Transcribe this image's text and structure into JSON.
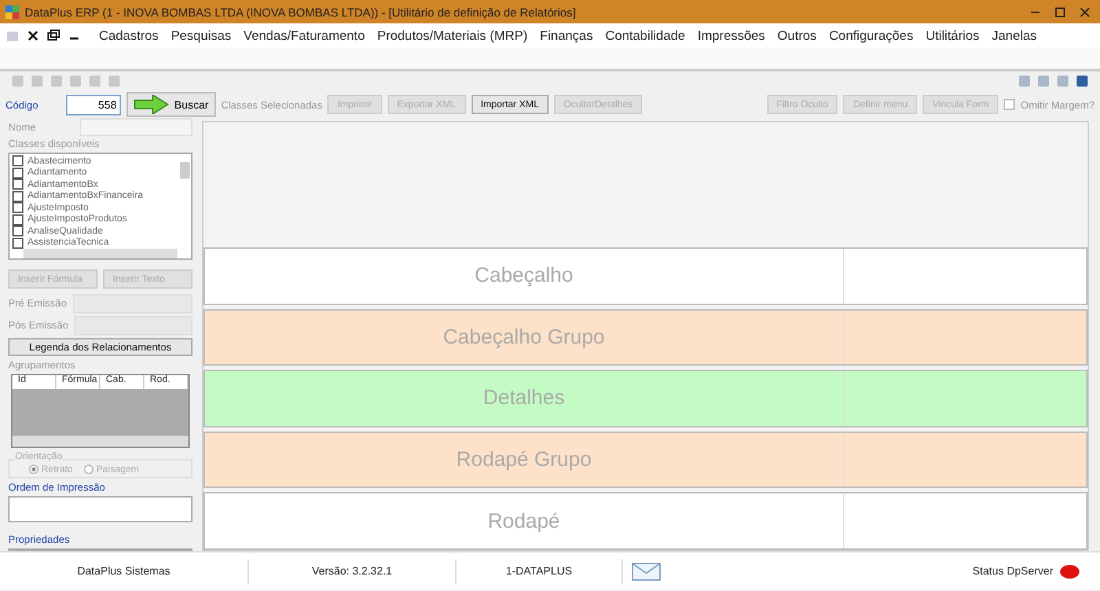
{
  "window": {
    "title": "DataPlus ERP (1 - INOVA BOMBAS LTDA  (INOVA BOMBAS LTDA)) - [Utilitário de definição de Relatórios]"
  },
  "menu": [
    "Cadastros",
    "Pesquisas",
    "Vendas/Faturamento",
    "Produtos/Materiais (MRP)",
    "Finanças",
    "Contabilidade",
    "Impressões",
    "Outros",
    "Configurações",
    "Utilitários",
    "Janelas"
  ],
  "codigo": {
    "label": "Código",
    "value": "558",
    "search_button": "Buscar"
  },
  "classes_selecionadas": "Classes Selecionadas",
  "actions": [
    {
      "label": "Imprimir",
      "disabled": true
    },
    {
      "label": "Exportar XML",
      "disabled": true
    },
    {
      "label": "Importar XML",
      "disabled": false
    },
    {
      "label": "OcultarDetalhes",
      "disabled": true
    }
  ],
  "right_actions": [
    {
      "label": "Filtro Oculto",
      "disabled": true
    },
    {
      "label": "Definir menu",
      "disabled": true
    },
    {
      "label": "Vincula Form",
      "disabled": true
    }
  ],
  "omitir_margem": {
    "label": "Omitir Margem?",
    "checked": false
  },
  "nome": {
    "label": "Nome"
  },
  "classes_disponiveis": {
    "label": "Classes disponíveis",
    "items": [
      {
        "label": "Abastecimento",
        "checked": false
      },
      {
        "label": "Adiantamento",
        "checked": false
      },
      {
        "label": "AdiantamentoBx",
        "checked": false
      },
      {
        "label": "AdiantamentoBxFinanceira",
        "checked": false
      },
      {
        "label": "AjusteImposto",
        "checked": false
      },
      {
        "label": "AjusteImpostoProdutos",
        "checked": false
      },
      {
        "label": "AnaliseQualidade",
        "checked": false
      },
      {
        "label": "AssistenciaTecnica",
        "checked": false
      }
    ]
  },
  "insert_buttons": [
    {
      "label": "Inserir Fórmula",
      "disabled": true
    },
    {
      "label": "Inserir Texto",
      "disabled": true
    }
  ],
  "pre_emissao": {
    "label": "Pré Emissão"
  },
  "pos_emissao": {
    "label": "Pós Emissão"
  },
  "legenda_button": "Legenda dos Relacionamentos",
  "agrupamentos": {
    "label": "Agrupamentos",
    "columns": [
      "Id",
      "Fórmula",
      "Cab.",
      "Rod."
    ]
  },
  "orientacao": {
    "label": "Orientação",
    "options": [
      {
        "label": "Retrato",
        "selected": true
      },
      {
        "label": "Paisagem",
        "selected": false
      }
    ]
  },
  "ordem_impressao": {
    "label": "Ordem de Impressão"
  },
  "propriedades": {
    "label": "Propriedades"
  },
  "bands": [
    {
      "label": "Cabeçalho",
      "color": "#ffffff"
    },
    {
      "label": "Cabeçalho Grupo",
      "color": "#fde1c8"
    },
    {
      "label": "Detalhes",
      "color": "#c4fbc4"
    },
    {
      "label": "Rodapé Grupo",
      "color": "#fde1c8"
    },
    {
      "label": "Rodapé",
      "color": "#ffffff"
    }
  ],
  "status_bar": {
    "company": "DataPlus Sistemas",
    "version": "Versão: 3.2.32.1",
    "user": "1-DATAPLUS",
    "server": "Status DpServer"
  }
}
